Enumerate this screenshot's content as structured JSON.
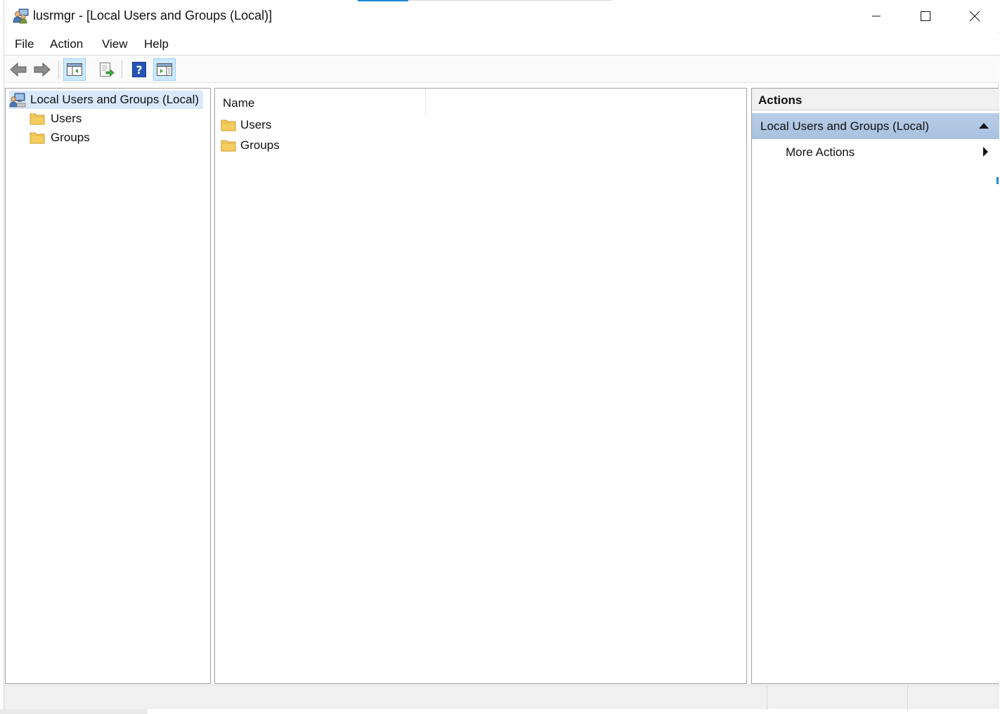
{
  "window": {
    "title": "lusrmgr - [Local Users and Groups (Local)]",
    "controls": [
      "minimize",
      "maximize",
      "close"
    ]
  },
  "menu": {
    "items": [
      "File",
      "Action",
      "View",
      "Help"
    ]
  },
  "toolbar": {
    "buttons": [
      {
        "name": "back-arrow-icon",
        "active": false
      },
      {
        "name": "forward-arrow-icon",
        "active": false
      },
      {
        "name": "show-hide-console-tree-icon",
        "active": true
      },
      {
        "name": "export-list-icon",
        "active": false
      },
      {
        "name": "help-icon",
        "active": false
      },
      {
        "name": "show-hide-action-pane-icon",
        "active": true
      }
    ]
  },
  "tree": {
    "root": "Local Users and Groups (Local)",
    "children": [
      "Users",
      "Groups"
    ]
  },
  "list": {
    "column": "Name",
    "items": [
      "Users",
      "Groups"
    ]
  },
  "actions": {
    "header": "Actions",
    "group_title": "Local Users and Groups (Local)",
    "items": [
      "More Actions"
    ]
  },
  "colors": {
    "selection": "#d9e8fa",
    "actions_group": "#b0c7e3",
    "accent": "#1e8ad6",
    "folder": "#f5cd5e"
  }
}
